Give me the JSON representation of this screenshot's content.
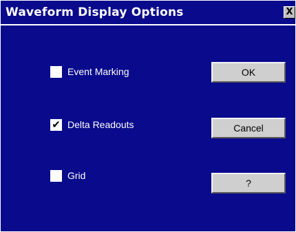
{
  "dialog": {
    "title": "Waveform Display Options",
    "close_label": "X"
  },
  "options": [
    {
      "label": "Event Marking",
      "checked": false
    },
    {
      "label": "Delta Readouts",
      "checked": true
    },
    {
      "label": "Grid",
      "checked": false
    }
  ],
  "buttons": {
    "ok": "OK",
    "cancel": "Cancel",
    "help": "?"
  },
  "colors": {
    "background": "#0a0a8c",
    "button_face": "#cfcfcf",
    "text": "#ffffff"
  },
  "icons": {
    "close": "close-icon",
    "check": "checkmark-icon"
  }
}
